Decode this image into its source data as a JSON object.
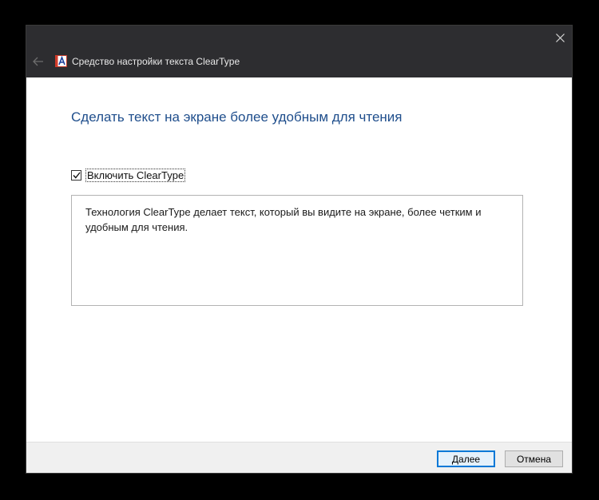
{
  "window": {
    "title": "Средство настройки текста ClearType",
    "icon": "cleartype-app-icon",
    "back_icon": "arrow-left-icon",
    "close_icon": "close-icon"
  },
  "content": {
    "heading": "Сделать текст на экране более удобным для чтения",
    "checkbox": {
      "label": "Включить ClearType",
      "checked": true
    },
    "description": "Технология ClearType делает текст, который вы видите на экране, более четким и удобным для чтения."
  },
  "footer": {
    "next_label": "Далее",
    "cancel_label": "Отмена"
  },
  "colors": {
    "heading": "#1f4e8c",
    "titlebar": "#2d2d30",
    "primary_button_border": "#0078d7"
  }
}
